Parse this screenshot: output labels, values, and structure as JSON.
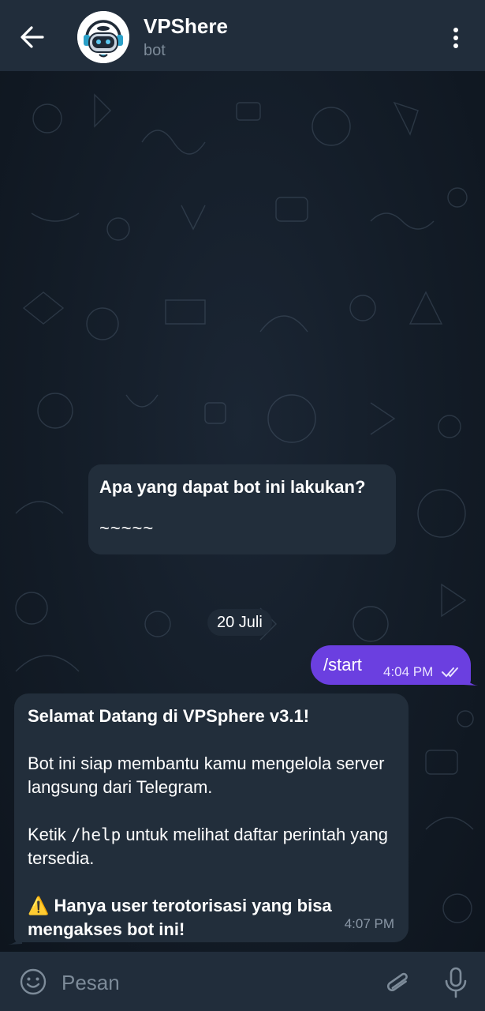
{
  "header": {
    "back_icon": "arrow-left-icon",
    "title": "VPShere",
    "subtitle": "bot",
    "avatar_icon": "robot-avatar-icon",
    "more_icon": "more-vertical-icon"
  },
  "intro": {
    "title": "Apa yang dapat bot ini lakukan?",
    "body": "~~~~~"
  },
  "date_label": "20 Juli",
  "messages": {
    "outgoing": {
      "text": "/start",
      "time": "4:04 PM",
      "status_icon": "double-check-icon"
    },
    "incoming": {
      "line1": "Selamat Datang di VPSphere v3.1!",
      "line2": "Bot ini siap membantu kamu mengelola server langsung dari Telegram.",
      "line3_pre": "Ketik ",
      "line3_code": "/help",
      "line3_post": " untuk melihat daftar perintah yang tersedia.",
      "line4_icon": "⚠️",
      "line4": "Hanya user terotorisasi yang bisa mengakses bot ini!",
      "time": "4:07 PM"
    }
  },
  "composer": {
    "placeholder": "Pesan",
    "emoji_icon": "emoji-icon",
    "attach_icon": "paperclip-icon",
    "mic_icon": "microphone-icon"
  },
  "colors": {
    "header_bg": "#212d3b",
    "bubble_in": "#222e3b",
    "bubble_out": "#6b3fe0",
    "muted": "#7d8b99"
  }
}
